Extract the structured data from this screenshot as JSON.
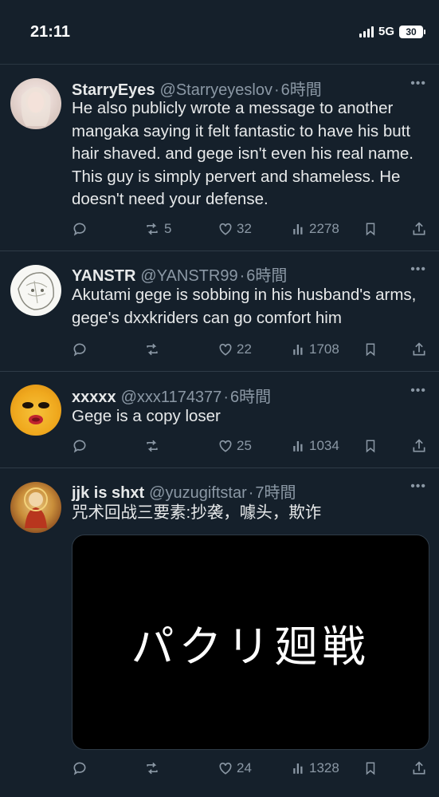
{
  "status": {
    "time": "21:11",
    "network": "5G",
    "battery": "30"
  },
  "tweets": [
    {
      "name": "StarryEyes",
      "handle": "@Starryeyeslov",
      "time": "6時間",
      "text": "He also publicly wrote a message to another mangaka saying it felt fantastic to have his butt hair shaved. and gege isn't even his real name. This guy is simply pervert and shameless. He doesn't need your defense.",
      "retweets": "5",
      "likes": "32",
      "views": "2278"
    },
    {
      "name": "YANSTR",
      "handle": "@YANSTR99",
      "time": "6時間",
      "text": "Akutami gege is sobbing in his husband's arms, gege's dxxkriders can go comfort him",
      "retweets": "",
      "likes": "22",
      "views": "1708"
    },
    {
      "name": "xxxxx",
      "handle": "@xxx1174377",
      "time": "6時間",
      "text": "Gege is a copy loser",
      "retweets": "",
      "likes": "25",
      "views": "1034"
    },
    {
      "name": "jjk is shxt",
      "handle": "@yuzugiftstar",
      "time": "7時間",
      "text": "咒术回战三要素:抄袭，噱头，欺诈",
      "media_text": "パクリ廻戦",
      "retweets": "",
      "likes": "24",
      "views": "1328"
    }
  ],
  "colors": {
    "background": "#15202b",
    "text": "#e7e9ea",
    "secondary": "#8b98a5",
    "divider": "#2f3b47"
  },
  "icons": [
    "reply-icon",
    "retweet-icon",
    "like-icon",
    "views-icon",
    "bookmark-icon",
    "share-icon",
    "more-icon"
  ]
}
